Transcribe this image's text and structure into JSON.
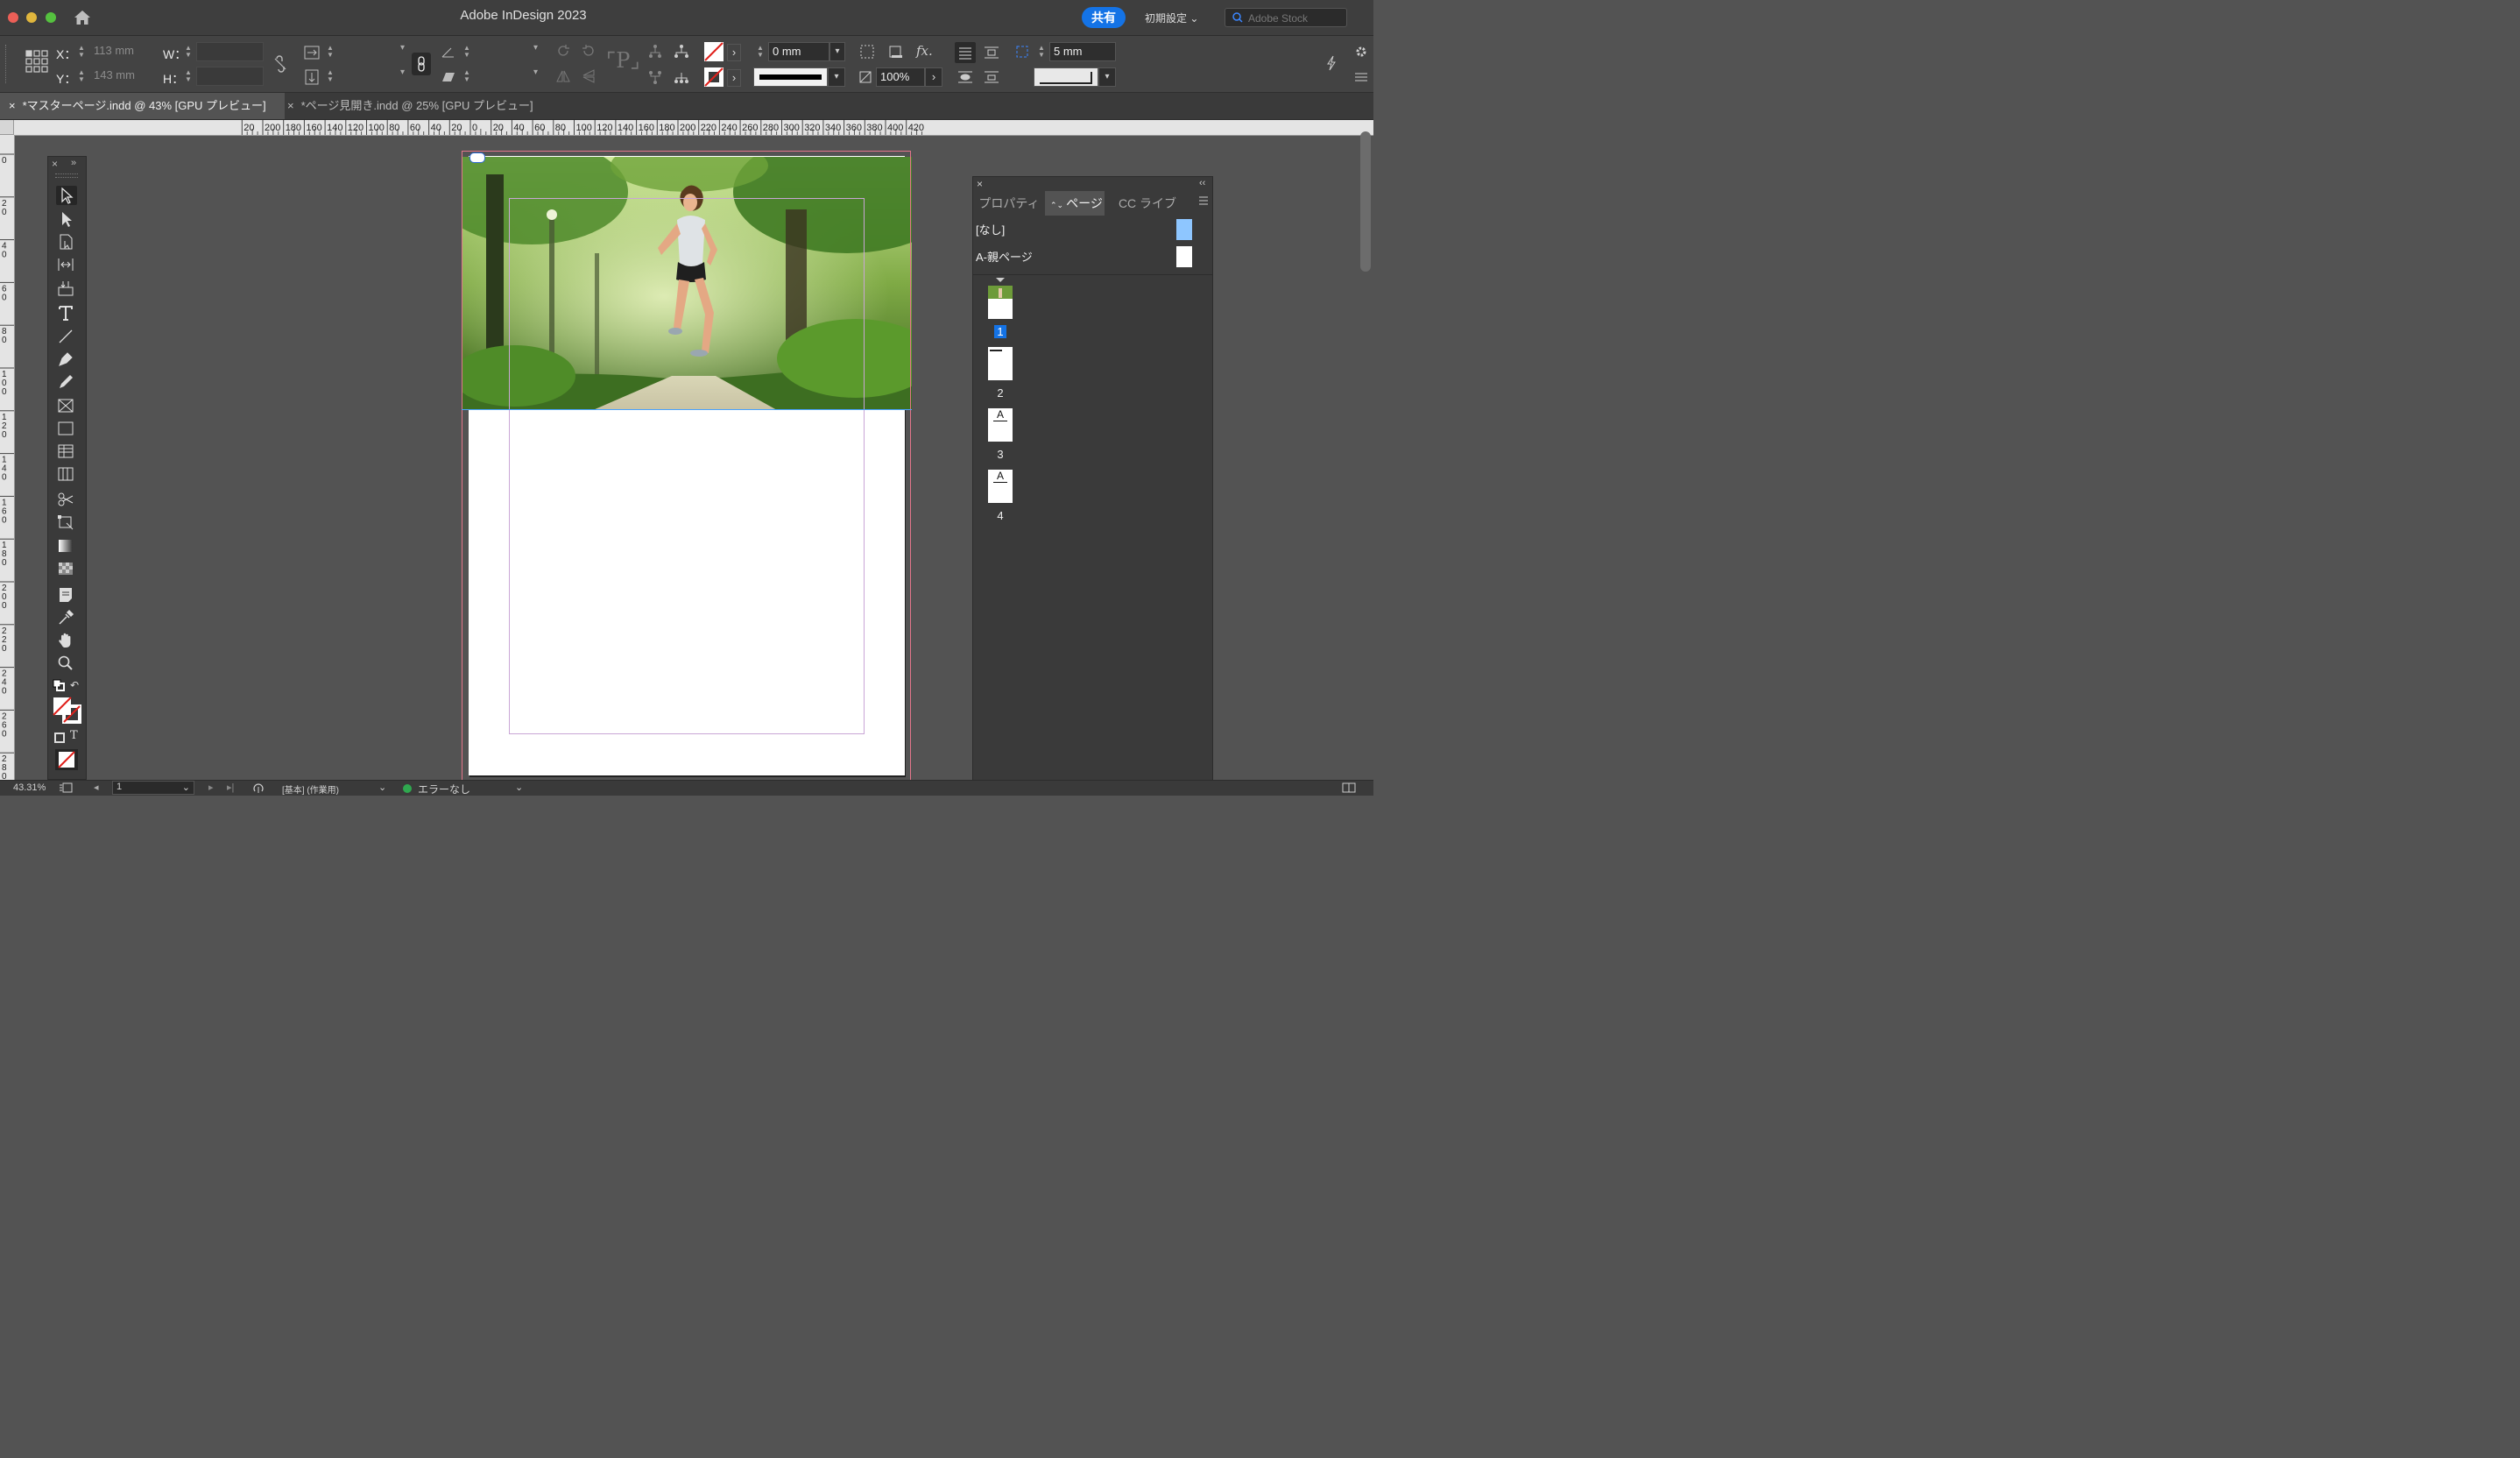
{
  "app": {
    "title": "Adobe InDesign 2023",
    "share_label": "共有",
    "workspace_label": "初期設定",
    "stock_placeholder": "Adobe Stock"
  },
  "control": {
    "x_label": "X：",
    "x_value": "113 mm",
    "y_label": "Y：",
    "y_value": "143 mm",
    "w_label": "W：",
    "w_value": "",
    "h_label": "H：",
    "h_value": "",
    "stroke_weight": "0 mm",
    "opacity": "100%",
    "gutter": "5 mm"
  },
  "tabs": [
    {
      "label": "*マスターページ.indd @ 43% [GPU プレビュー]",
      "active": true
    },
    {
      "label": "*ページ見開き.indd @ 25% [GPU プレビュー]",
      "active": false
    }
  ],
  "rulers": {
    "horizontal": [
      "20",
      "200",
      "180",
      "160",
      "140",
      "120",
      "100",
      "80",
      "60",
      "40",
      "20",
      "0",
      "20",
      "40",
      "60",
      "80",
      "100",
      "120",
      "140",
      "160",
      "180",
      "200",
      "220",
      "240",
      "260",
      "280",
      "300",
      "320",
      "340",
      "360",
      "380",
      "400",
      "420"
    ],
    "vertical": [
      "0",
      "20",
      "40",
      "60",
      "80",
      "100",
      "120",
      "140",
      "160",
      "180",
      "200",
      "220",
      "240",
      "260",
      "280"
    ]
  },
  "pages_panel": {
    "tabs": [
      "プロパティ",
      "ページ",
      "CC ライブ"
    ],
    "masters": [
      {
        "label": "[なし]",
        "color": "#8ec6ff"
      },
      {
        "label": "A-親ページ",
        "color": "#ffffff"
      }
    ],
    "pages": [
      {
        "number": "1",
        "selected": true,
        "thumb": "photo"
      },
      {
        "number": "2",
        "selected": false,
        "thumb": "line"
      },
      {
        "number": "3",
        "selected": false,
        "thumb": "A"
      },
      {
        "number": "4",
        "selected": false,
        "thumb": "A"
      }
    ],
    "master_letter": "A"
  },
  "status": {
    "zoom": "43.31%",
    "page": "1",
    "profile": "[基本] (作業用)",
    "preflight": "エラーなし"
  },
  "colors": {
    "accent": "#1473e6",
    "bleed_guide": "#e3768a",
    "margin_guide": "#c9a6d6",
    "preflight_ok": "#2fa84f"
  }
}
